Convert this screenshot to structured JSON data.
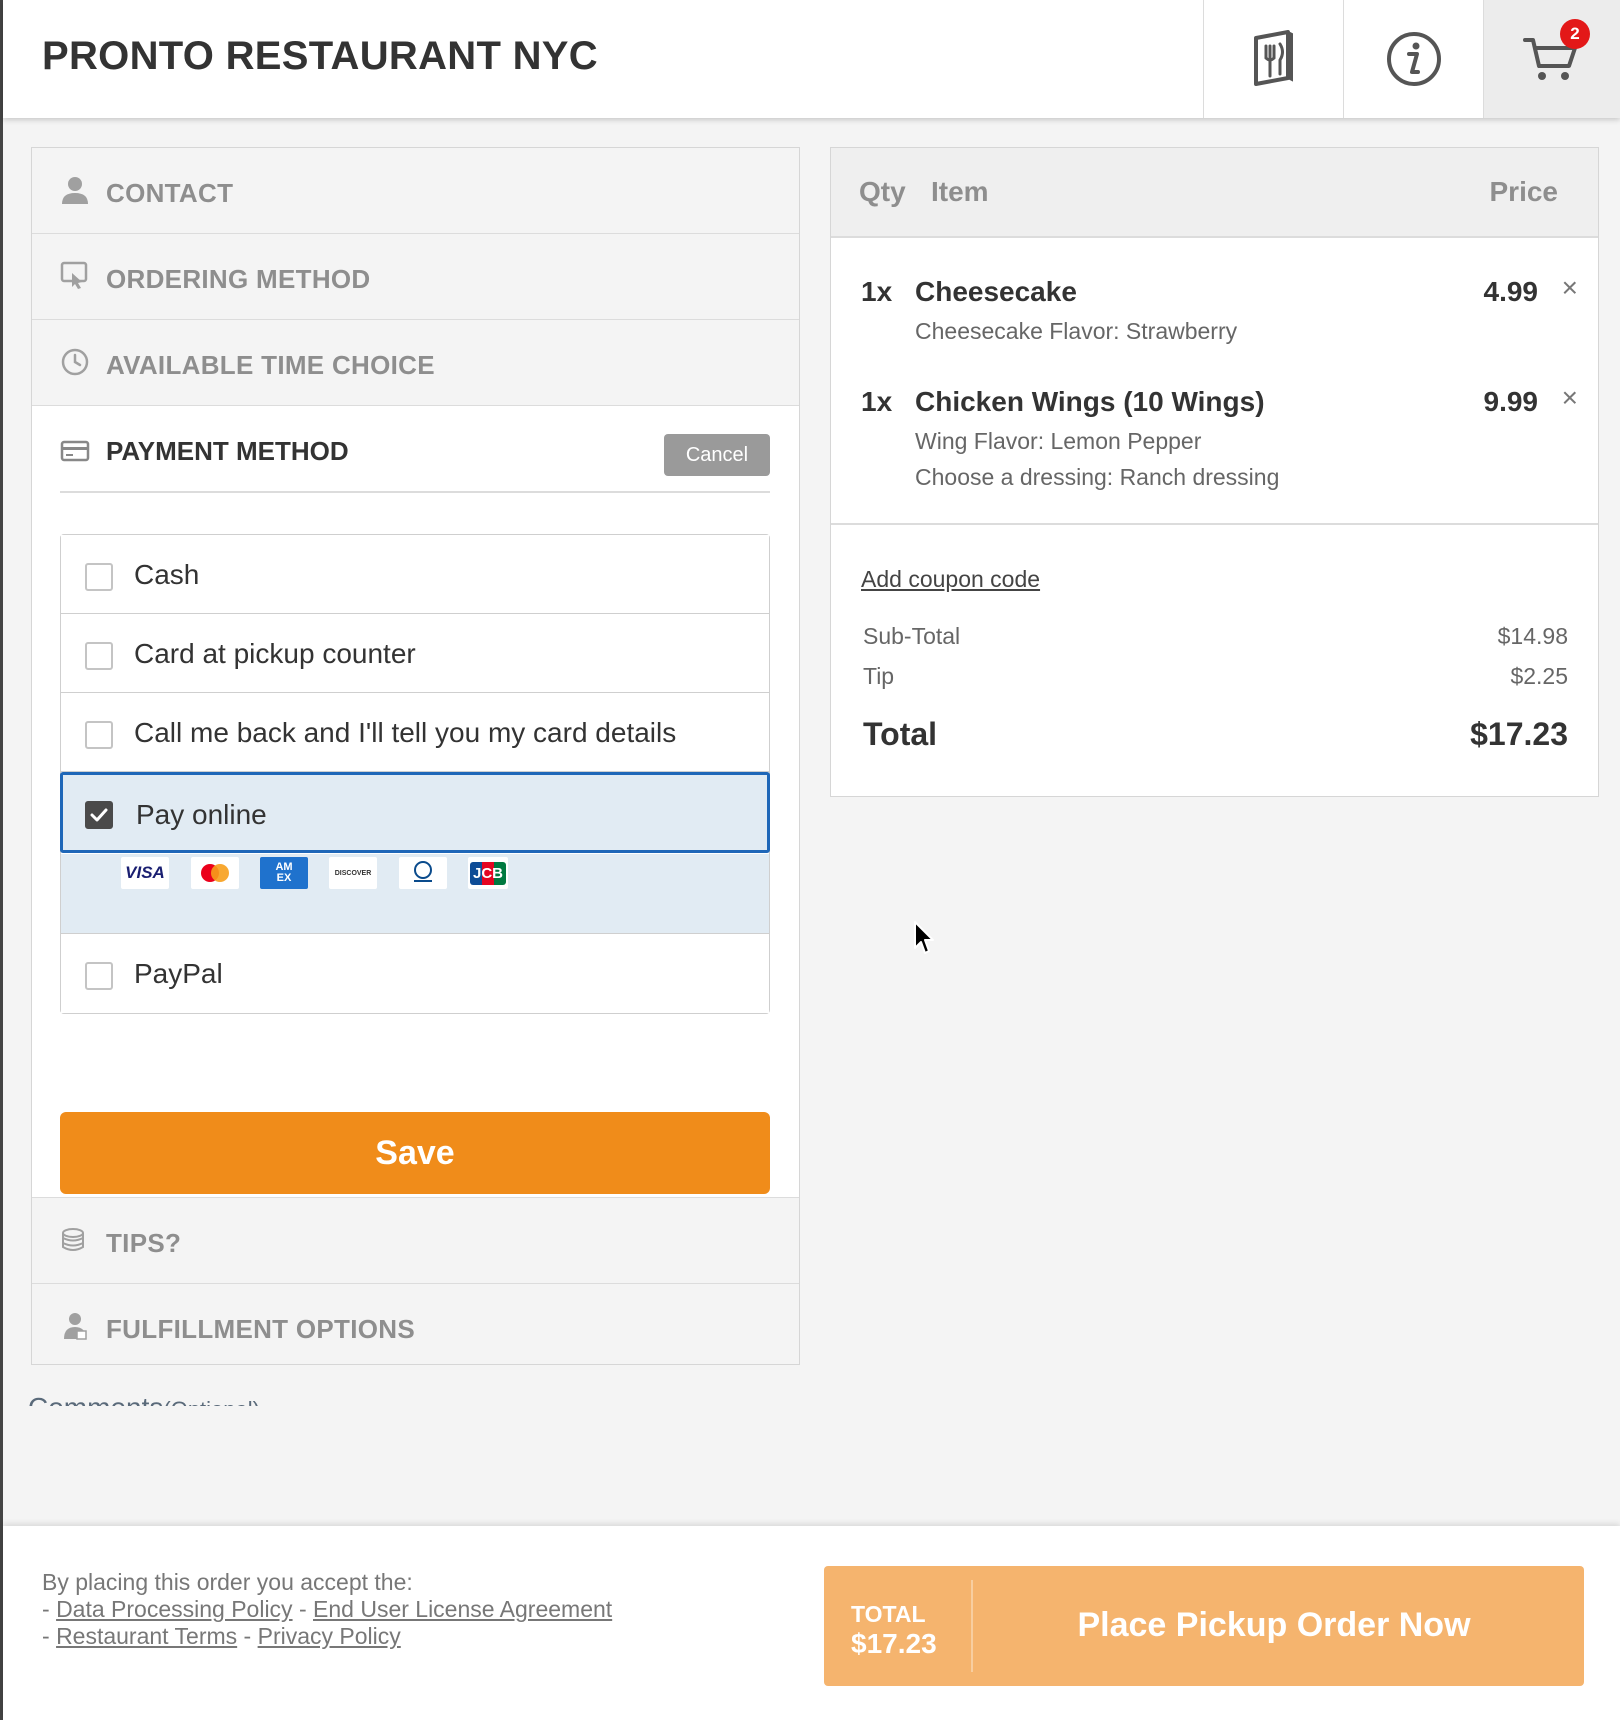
{
  "header": {
    "restaurant_name": "PRONTO RESTAURANT NYC",
    "menu_icon": "menu-book-icon",
    "info_icon": "info-icon",
    "cart_icon": "shopping-cart-icon",
    "cart_count": "2"
  },
  "sections": {
    "contact": "CONTACT",
    "ordering_method": "ORDERING METHOD",
    "available_time": "AVAILABLE TIME CHOICE",
    "payment_method": "PAYMENT METHOD",
    "tips": "TIPS?",
    "fulfillment": "FULFILLMENT OPTIONS"
  },
  "payment": {
    "cancel_label": "Cancel",
    "options": [
      {
        "label": "Cash",
        "checked": false
      },
      {
        "label": "Card at pickup counter",
        "checked": false
      },
      {
        "label": "Call me back and I'll tell you my card details",
        "checked": false
      },
      {
        "label": "Pay online",
        "checked": true
      },
      {
        "label": "PayPal",
        "checked": false
      }
    ],
    "card_logos": [
      "visa",
      "mastercard",
      "amex",
      "discover",
      "diners-club",
      "jcb"
    ],
    "card_logo_text": {
      "visa": "VISA",
      "amex": "AM EX",
      "discover": "DISCOVER",
      "jcb": "JCB"
    },
    "save_label": "Save"
  },
  "cart": {
    "col_qty": "Qty",
    "col_item": "Item",
    "col_price": "Price",
    "items": [
      {
        "qty": "1x",
        "name": "Cheesecake",
        "price": "4.99",
        "modifiers": [
          "Cheesecake Flavor: Strawberry"
        ]
      },
      {
        "qty": "1x",
        "name": "Chicken Wings (10 Wings)",
        "price": "9.99",
        "modifiers": [
          "Wing Flavor: Lemon Pepper",
          "Choose a dressing: Ranch dressing"
        ]
      }
    ],
    "remove_symbol": "×",
    "coupon_link": "Add coupon code",
    "subtotal_label": "Sub-Total",
    "subtotal_value": "$14.98",
    "tip_label": "Tip",
    "tip_value": "$2.25",
    "total_label": "Total",
    "total_value": "$17.23"
  },
  "comments": {
    "label": "Comments",
    "optional": "(Optional)"
  },
  "footer": {
    "accept_text": "By placing this order you accept the:",
    "dash": "-",
    "data_policy": "Data Processing Policy",
    "eula": "End User License Agreement",
    "restaurant_terms": "Restaurant Terms",
    "privacy_policy": "Privacy Policy",
    "total_label": "TOTAL",
    "total_value": "$17.23",
    "place_order_label": "Place Pickup Order Now"
  },
  "colors": {
    "accent_orange": "#f08c1a",
    "place_order_orange": "#f5b46e",
    "selected_border": "#1f67b8",
    "selected_bg": "#e1ebf3",
    "badge_red": "#e31818"
  }
}
